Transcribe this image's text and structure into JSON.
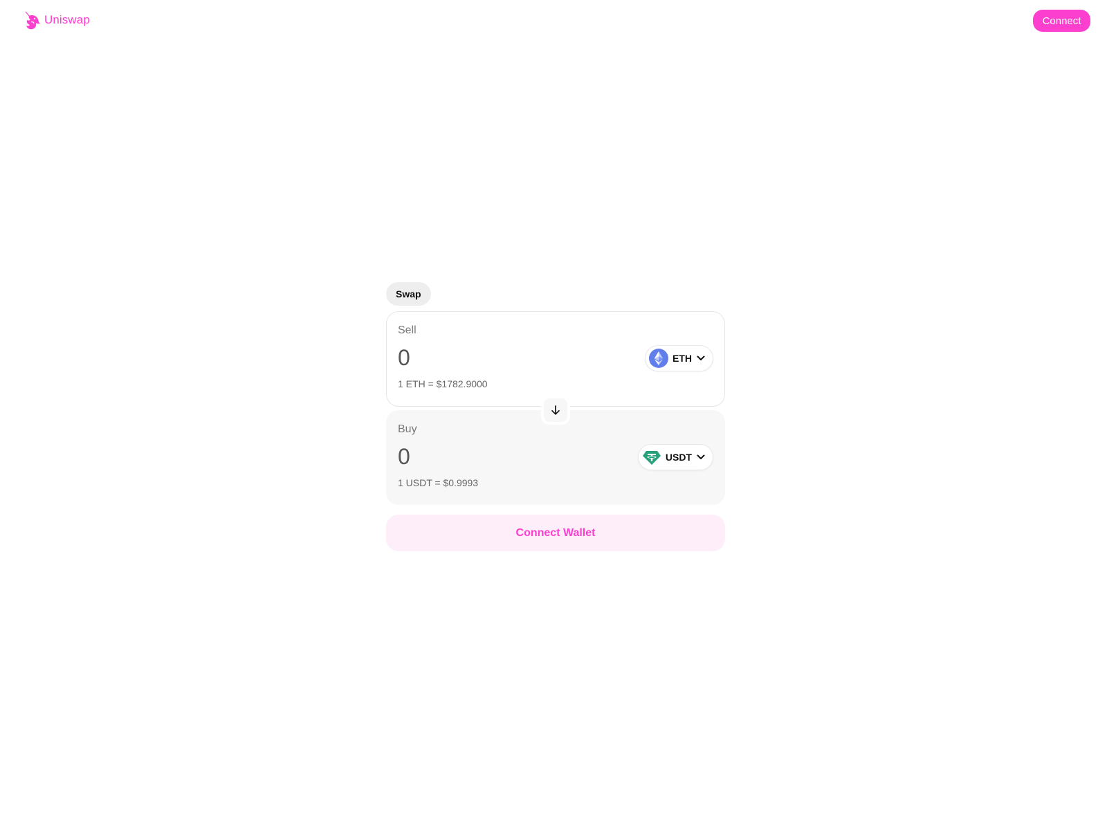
{
  "header": {
    "brand_name": "Uniswap",
    "connect_label": "Connect"
  },
  "swap": {
    "tab_label": "Swap",
    "sell": {
      "label": "Sell",
      "amount": "0",
      "token_symbol": "ETH",
      "token_icon": "ethereum-icon",
      "rate": "1 ETH = $1782.9000"
    },
    "buy": {
      "label": "Buy",
      "amount": "0",
      "token_symbol": "USDT",
      "token_icon": "tether-icon",
      "rate": "1 USDT = $0.9993"
    },
    "flip_icon": "arrow-down-icon",
    "connect_wallet_label": "Connect Wallet"
  },
  "colors": {
    "accent": "#fc3fce",
    "accent_soft": "#fdeefa",
    "eth": "#627eea",
    "usdt": "#26a17b"
  }
}
